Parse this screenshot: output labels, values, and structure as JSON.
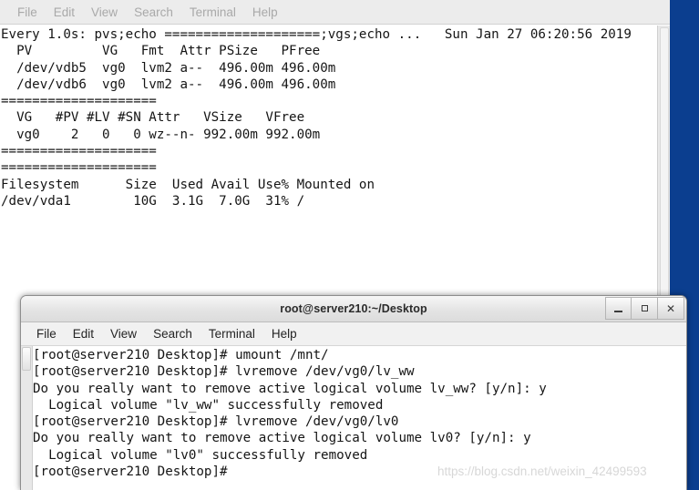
{
  "desktop": {
    "background_color": "#0b3e8f"
  },
  "outer_window": {
    "name": "watch-terminal",
    "menu": [
      "File",
      "Edit",
      "View",
      "Search",
      "Terminal",
      "Help"
    ],
    "header_line": "Every 1.0s: pvs;echo ====================;vgs;echo ...   Sun Jan 27 06:20:56 2019",
    "watch_interval": "Every 1.0s:",
    "watch_command": "pvs;echo ====================;vgs;echo ...",
    "watch_timestamp": "Sun Jan 27 06:20:56 2019",
    "content": "\n  PV         VG   Fmt  Attr PSize   PFree\n  /dev/vdb5  vg0  lvm2 a--  496.00m 496.00m\n  /dev/vdb6  vg0  lvm2 a--  496.00m 496.00m\n====================\n  VG   #PV #LV #SN Attr   VSize   VFree\n  vg0    2   0   0 wz--n- 992.00m 992.00m\n====================\n====================\nFilesystem      Size  Used Avail Use% Mounted on\n/dev/vda1        10G  3.1G  7.0G  31% /",
    "pvs_table": {
      "headers": [
        "PV",
        "VG",
        "Fmt",
        "Attr",
        "PSize",
        "PFree"
      ],
      "rows": [
        [
          "/dev/vdb5",
          "vg0",
          "lvm2",
          "a--",
          "496.00m",
          "496.00m"
        ],
        [
          "/dev/vdb6",
          "vg0",
          "lvm2",
          "a--",
          "496.00m",
          "496.00m"
        ]
      ]
    },
    "vgs_table": {
      "headers": [
        "VG",
        "#PV",
        "#LV",
        "#SN",
        "Attr",
        "VSize",
        "VFree"
      ],
      "rows": [
        [
          "vg0",
          "2",
          "0",
          "0",
          "wz--n-",
          "992.00m",
          "992.00m"
        ]
      ]
    },
    "df_table": {
      "headers": [
        "Filesystem",
        "Size",
        "Used",
        "Avail",
        "Use%",
        "Mounted on"
      ],
      "rows": [
        [
          "/dev/vda1",
          "10G",
          "3.1G",
          "7.0G",
          "31%",
          "/"
        ]
      ]
    },
    "separator": "===================="
  },
  "inner_window": {
    "name": "root-terminal",
    "title": "root@server210:~/Desktop",
    "menu": [
      "File",
      "Edit",
      "View",
      "Search",
      "Terminal",
      "Help"
    ],
    "window_buttons": {
      "minimize": "minimize-icon",
      "maximize": "maximize-icon",
      "close": "✕"
    },
    "prompt": "[root@server210 Desktop]#",
    "content": "[root@server210 Desktop]# umount /mnt/\n[root@server210 Desktop]# lvremove /dev/vg0/lv_ww\nDo you really want to remove active logical volume lv_ww? [y/n]: y\n  Logical volume \"lv_ww\" successfully removed\n[root@server210 Desktop]# lvremove /dev/vg0/lv0\nDo you really want to remove active logical volume lv0? [y/n]: y\n  Logical volume \"lv0\" successfully removed\n[root@server210 Desktop]#",
    "lines": [
      "[root@server210 Desktop]# umount /mnt/",
      "[root@server210 Desktop]# lvremove /dev/vg0/lv_ww",
      "Do you really want to remove active logical volume lv_ww? [y/n]: y",
      "  Logical volume \"lv_ww\" successfully removed",
      "[root@server210 Desktop]# lvremove /dev/vg0/lv0",
      "Do you really want to remove active logical volume lv0? [y/n]: y",
      "  Logical volume \"lv0\" successfully removed",
      "[root@server210 Desktop]#"
    ]
  },
  "watermark": {
    "text": "https://blog.csdn.net/weixin_42499593"
  }
}
